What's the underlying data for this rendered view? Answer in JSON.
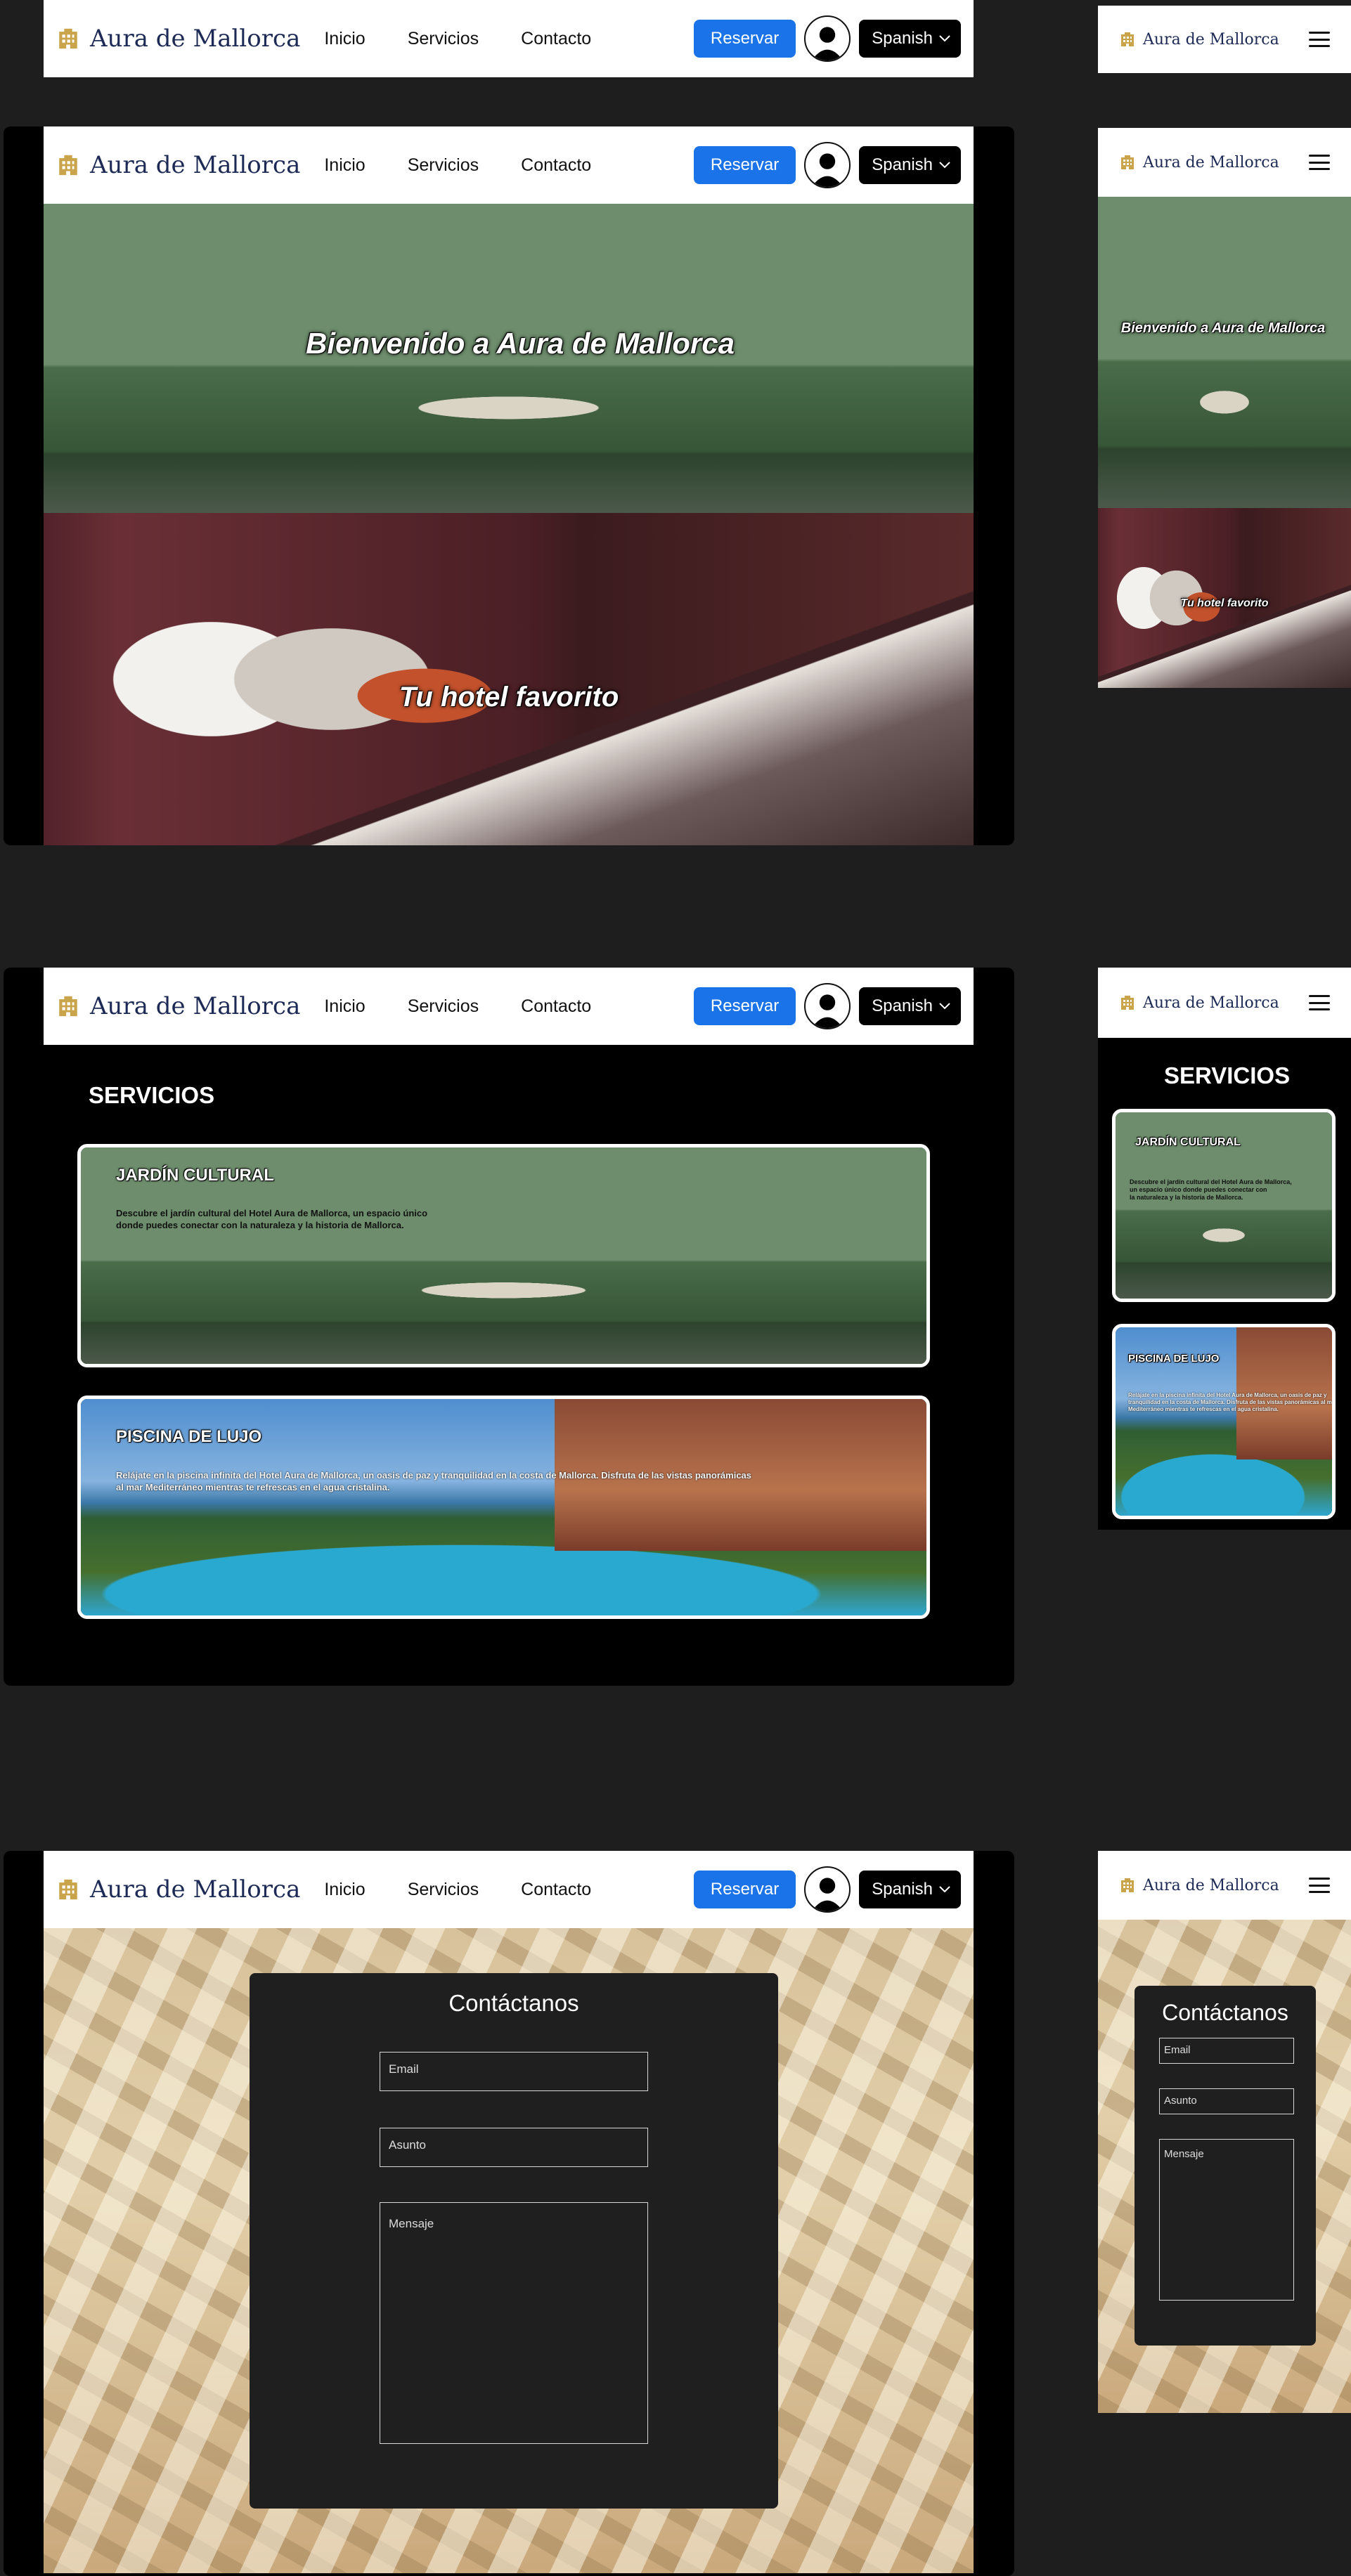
{
  "brand": "Aura de Mallorca",
  "nav": {
    "links": [
      "Inicio",
      "Servicios",
      "Contacto"
    ],
    "reservar": "Reservar",
    "language": "Spanish"
  },
  "hero": {
    "welcome": "Bienvenido a Aura de Mallorca",
    "tagline": "Tu hotel favorito"
  },
  "services": {
    "title": "SERVICIOS",
    "items": [
      {
        "title": "JARDÍN CULTURAL",
        "desc_line1": "Descubre el jardín cultural del Hotel Aura de Mallorca, un espacio único",
        "desc_line2": "donde puedes conectar con la naturaleza y la historia de Mallorca.",
        "mobile_line1": "Descubre el jardín cultural del Hotel Aura de Mallorca,",
        "mobile_line2": "un espacio único donde puedes conectar con",
        "mobile_line3": "la naturaleza y la historia de Mallorca."
      },
      {
        "title": "PISCINA DE LUJO",
        "desc_line1": "Relájate en la piscina infinita del Hotel Aura de Mallorca, un oasis de paz y tranquilidad en la costa de Mallorca. Disfruta de las vistas panorámicas",
        "desc_line2": "al mar Mediterráneo mientras te refrescas en el agua cristalina.",
        "mobile_line1": "Relájate en la piscina infinita del Hotel Aura de Mallorca, un oasis de paz y",
        "mobile_line2": "tranquilidad en la costa de Mallorca. Disfruta de las vistas panorámicas al mar",
        "mobile_line3": "Mediterráneo mientras te refrescas en el agua cristalina."
      }
    ]
  },
  "contact": {
    "title": "Contáctanos",
    "email_placeholder": "Email",
    "subject_placeholder": "Asunto",
    "message_placeholder": "Mensaje"
  },
  "colors": {
    "page_bg": "#1e1e1e",
    "frame_bg": "#000000",
    "brand_text": "#1c2a55",
    "logo_gold": "#c9a44a",
    "reservar_bg": "#1a73e8",
    "panel_bg": "#1f1f1f"
  },
  "icons": [
    "hotel-logo-icon",
    "user-avatar-icon",
    "chevron-down-icon",
    "hamburger-menu-icon"
  ]
}
